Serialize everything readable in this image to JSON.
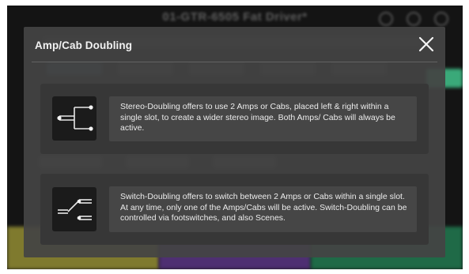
{
  "background": {
    "title": "01-GTR-6505 Fat Driver*",
    "colors": {
      "screen_bg": "#141414",
      "bottom_yellow": "#7f7a2e",
      "bottom_purple": "#4e2f72",
      "bottom_green": "#1f6a47",
      "accent_green": "#3aa979"
    }
  },
  "modal": {
    "title": "Amp/Cab Doubling",
    "close_icon": "close-icon",
    "options": [
      {
        "icon": "stereo-doubling-icon",
        "description": "Stereo-Doubling offers to use 2 Amps or Cabs, placed left & right within a single slot, to create a wider stereo image. Both Amps/ Cabs will always be active."
      },
      {
        "icon": "switch-doubling-icon",
        "description": "Switch-Doubling offers to switch between 2 Amps or Cabs within a single slot. At any time, only one of the Amps/Cabs will be active. Switch-Doubling can be controlled via footswitches, and also Scenes."
      }
    ],
    "colors": {
      "modal_bg": "#444444",
      "card_bg": "#373737",
      "text_box_bg": "#464646",
      "icon_bg": "#1b1b1b",
      "text": "#ececec"
    }
  }
}
